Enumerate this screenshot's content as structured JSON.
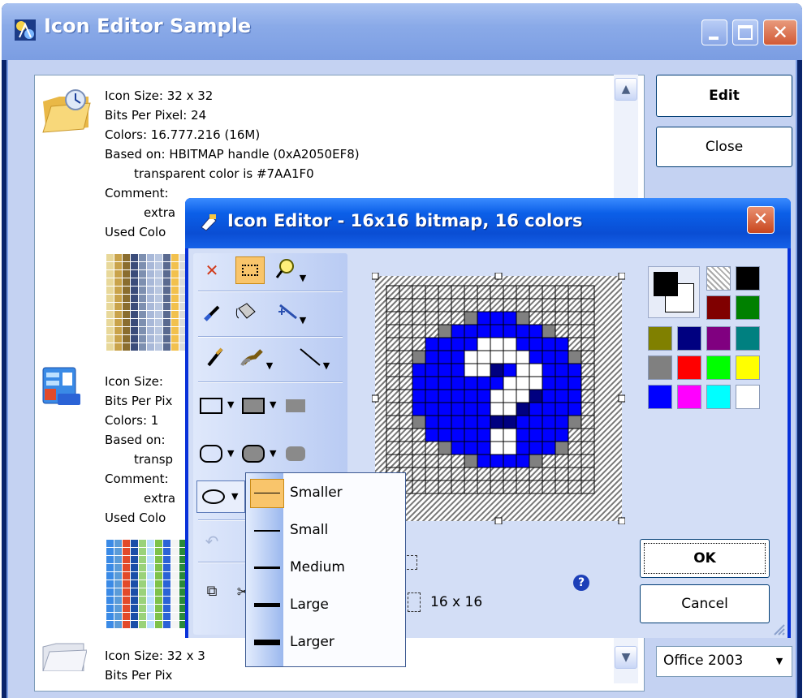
{
  "window": {
    "title": "Icon Editor Sample",
    "caption_buttons": [
      "minimize",
      "maximize",
      "close"
    ]
  },
  "icon_list": {
    "items": [
      {
        "icon": "folder-clock-icon",
        "size_line": "Icon Size:  32 x 32",
        "bpp_line": "Bits Per Pixel:  24",
        "colors_line": "Colors:  16.777.216 (16M)",
        "based_line": "Based on:  HBITMAP handle (0xA2050EF8)",
        "transparent_line": "transparent color is #7AA1F0",
        "comment_line": "Comment:",
        "extra_line": "extra",
        "used_colors_line": "Used Colo"
      },
      {
        "icon": "windows-panel-icon",
        "size_line": "Icon Size:",
        "bpp_line": "Bits Per Pix",
        "colors_line": "Colors:  1",
        "based_line": "Based on:",
        "transparent_line": "transp",
        "comment_line": "Comment:",
        "extra_line": "extra",
        "used_colors_line": "Used Colo"
      },
      {
        "icon": "folder-icon",
        "size_line": "Icon Size:  32 x 3",
        "bpp_line": "Bits Per Pix"
      }
    ]
  },
  "buttons": {
    "edit": "Edit",
    "close": "Close"
  },
  "theme_select": {
    "value": "Office 2003"
  },
  "dialog": {
    "title": "Icon Editor - 16x16 bitmap, 16 colors",
    "ok": "OK",
    "cancel": "Cancel",
    "size_label": "16 x 16",
    "help_glyph": "?",
    "tools": [
      "erase-icon",
      "rect-select-icon",
      "zoom-icon",
      "eyedropper-icon",
      "fill-icon",
      "magic-wand-icon",
      "pencil-icon",
      "brush-icon",
      "line-icon",
      "rectangle-outline-icon",
      "rectangle-filled-icon",
      "rectangle-flat-icon",
      "rounded-rect-outline-icon",
      "rounded-rect-filled-icon",
      "rounded-rect-flat-icon",
      "ellipse-icon",
      "undo-icon",
      "copy-icon",
      "cut-icon"
    ],
    "palette": {
      "foreground": "#000000",
      "background": "#ffffff",
      "colors": [
        "transparent",
        "#000000",
        "#800000",
        "#008000",
        "#808000",
        "#000080",
        "#800080",
        "#008080",
        "#808080",
        "#ff0000",
        "#00ff00",
        "#ffff00",
        "#0000ff",
        "#ff00ff",
        "#00ffff",
        "#ffffff"
      ]
    }
  },
  "line_width_menu": {
    "items": [
      {
        "label": "Smaller",
        "selected": true
      },
      {
        "label": "Small",
        "selected": false
      },
      {
        "label": "Medium",
        "selected": false
      },
      {
        "label": "Large",
        "selected": false
      },
      {
        "label": "Larger",
        "selected": false
      }
    ]
  }
}
